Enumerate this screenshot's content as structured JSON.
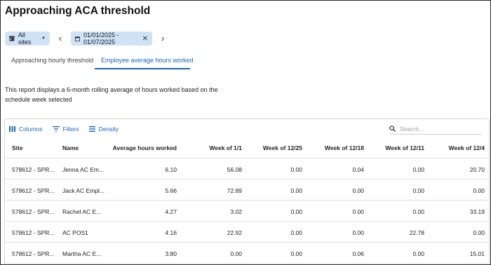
{
  "page": {
    "title": "Approaching ACA threshold"
  },
  "filters": {
    "sites_label": "All sites",
    "date_range": "01/01/2025 - 01/07/2025"
  },
  "tabs": [
    {
      "label": "Approaching hourly threshold",
      "active": false
    },
    {
      "label": "Employee average hours worked",
      "active": true
    }
  ],
  "description": "This report displays a 6-month rolling average of hours worked based on the schedule week selected",
  "toolbar": {
    "columns_label": "Columns",
    "filters_label": "Filters",
    "density_label": "Density",
    "search_placeholder": "Search..."
  },
  "table": {
    "headers": [
      "Site",
      "Name",
      "Average hours worked",
      "Week of 1/1",
      "Week of 12/25",
      "Week of 12/18",
      "Week of 12/11",
      "Week of 12/4"
    ],
    "rows": [
      [
        "578612 - SPR...",
        "Jenna AC Em...",
        "6.10",
        "56.08",
        "0.00",
        "0.04",
        "0.00",
        "20.70"
      ],
      [
        "578612 - SPR...",
        "Jack AC Empl...",
        "5.66",
        "72.89",
        "0.00",
        "0.00",
        "0.00",
        "0.00"
      ],
      [
        "578612 - SPR...",
        "Rachel AC E...",
        "4.27",
        "3.02",
        "0.00",
        "0.00",
        "0.00",
        "33.19"
      ],
      [
        "578612 - SPR...",
        "AC POS1",
        "4.16",
        "22.92",
        "0.00",
        "0.00",
        "22.78",
        "0.00"
      ],
      [
        "578612 - SPR...",
        "Martha AC E...",
        "3.80",
        "0.00",
        "0.00",
        "0.06",
        "0.00",
        "15.01"
      ]
    ]
  },
  "colors": {
    "accent": "#1565c0",
    "chip_bg": "#cfe3f7",
    "border": "#d6d6d6"
  },
  "icons": [
    "store-icon",
    "chevron-down-icon",
    "chevron-left-icon",
    "calendar-icon",
    "close-icon",
    "chevron-right-icon",
    "columns-icon",
    "filter-icon",
    "density-icon",
    "search-icon"
  ]
}
